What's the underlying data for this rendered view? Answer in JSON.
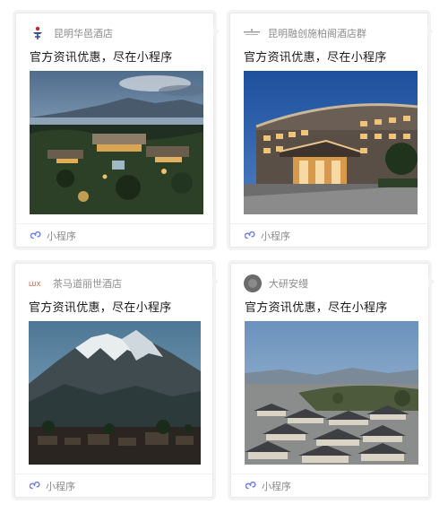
{
  "cards": [
    {
      "brand": {
        "name": "昆明华邑酒店",
        "icon": "huayi-logo-icon",
        "color": "#c1272d"
      },
      "title": "官方资讯优惠，尽在小程序",
      "photo": "resort-aerial-lake-mountains-dusk",
      "footer": {
        "label": "小程序",
        "icon": "mini-program-icon"
      }
    },
    {
      "brand": {
        "name": "昆明融创施柏阁酒店群",
        "icon": "steigenberger-logo-icon",
        "color": "#8a8a8a"
      },
      "title": "官方资讯优惠，尽在小程序",
      "photo": "hotel-facade-night",
      "footer": {
        "label": "小程序",
        "icon": "mini-program-icon"
      }
    },
    {
      "brand": {
        "name": "茶马道丽世酒店",
        "icon": "lux-logo-icon",
        "color": "#d4542f"
      },
      "title": "官方资讯优惠，尽在小程序",
      "photo": "snow-mountain-village",
      "footer": {
        "label": "小程序",
        "icon": "mini-program-icon"
      }
    },
    {
      "brand": {
        "name": "大研安缦",
        "icon": "amanemblem-avatar-icon",
        "color": "#6b6b6b"
      },
      "title": "官方资讯优惠，尽在小程序",
      "photo": "old-town-rooftops-aerial",
      "footer": {
        "label": "小程序",
        "icon": "mini-program-icon"
      }
    }
  ],
  "colors": {
    "mini_program_icon": "#6b7ef0",
    "brand_text": "#8c8c8c",
    "title_text": "#1a1a1a"
  }
}
